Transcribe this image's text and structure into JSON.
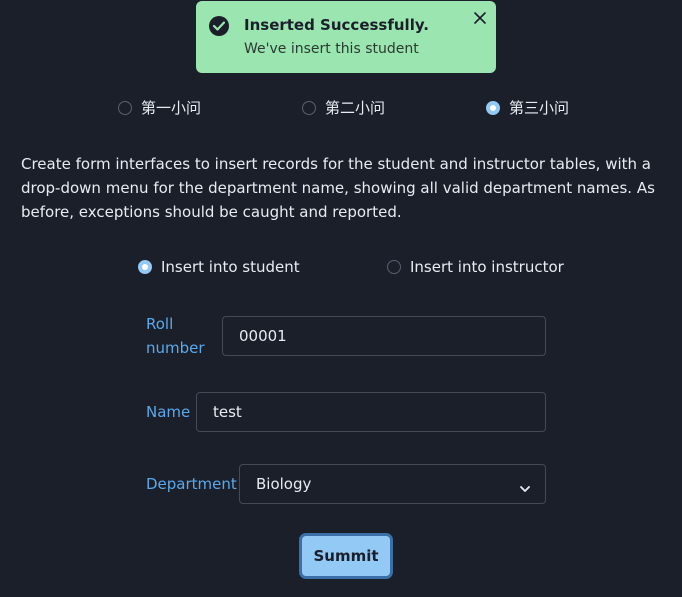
{
  "toast": {
    "title": "Inserted Successfully.",
    "message": "We've insert this student",
    "icon": "check-circle-icon",
    "close_icon": "close-icon",
    "background": "#9be5b0"
  },
  "question_tabs": [
    {
      "label": "第一小问",
      "checked": false
    },
    {
      "label": "第二小问",
      "checked": false
    },
    {
      "label": "第三小问",
      "checked": true
    }
  ],
  "description": "Create form interfaces to insert records for the student and instructor tables, with a drop-down menu for the department name, showing all valid department names. As before, exceptions should be caught and reported.",
  "insert_target": [
    {
      "label": "Insert into student",
      "checked": true
    },
    {
      "label": "Insert into instructor",
      "checked": false
    }
  ],
  "form": {
    "roll_label_line1": "Roll",
    "roll_label_line2": "number",
    "roll_value": "00001",
    "name_label": "Name",
    "name_value": "test",
    "department_label": "Department",
    "department_value": "Biology"
  },
  "submit_label": "Summit",
  "colors": {
    "background": "#1b1f2a",
    "accent": "#92c9f5",
    "label": "#5aa9ec",
    "success": "#9be5b0"
  }
}
